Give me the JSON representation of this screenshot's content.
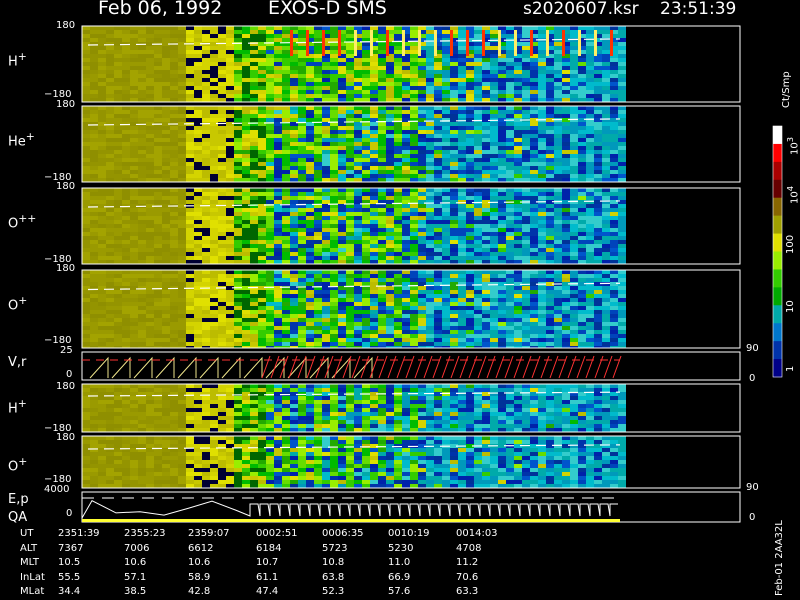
{
  "header": {
    "date": "Feb 06, 1992",
    "instrument": "EXOS-D SMS",
    "file": "s2020607.ksr",
    "time": "23:51:39"
  },
  "panels": {
    "h1": {
      "label": "H",
      "sup": "+",
      "top": "180",
      "bottom": "−180"
    },
    "he": {
      "label": "He",
      "sup": "+",
      "top": "180",
      "bottom": "−180"
    },
    "o2": {
      "label": "O",
      "sup": "++",
      "top": "180",
      "bottom": "−180"
    },
    "o1": {
      "label": "O",
      "sup": "+",
      "top": "180",
      "bottom": "−180"
    },
    "vr": {
      "label": "V,r",
      "top": "25",
      "bottom": "0",
      "right_top": "90",
      "right_bottom": "0"
    },
    "h2": {
      "label": "H",
      "sup": "+",
      "top": "180",
      "bottom": "−180"
    },
    "o3": {
      "label": "O",
      "sup": "+",
      "top": "180",
      "bottom": "−180"
    },
    "ep": {
      "label1": "E,p",
      "label2": "QA",
      "top": "4000",
      "bottom": "0",
      "right_top": "90",
      "right_bottom": "0"
    }
  },
  "colorbar": {
    "unit": "Ct/Smp",
    "labels": {
      "l1": "1",
      "l10": "10",
      "l100": "100",
      "l1000": "10",
      "l1000_exp": "3",
      "l10000": "10",
      "l10000_exp": "4"
    }
  },
  "side_note": "Feb-01  2AA32L",
  "footer": {
    "rows": [
      {
        "name": "UT",
        "values": [
          "2351:39",
          "2355:23",
          "2359:07",
          "0002:51",
          "0006:35",
          "0010:19",
          "0014:03"
        ]
      },
      {
        "name": "ALT",
        "values": [
          "7367",
          "7006",
          "6612",
          "6184",
          "5723",
          "5230",
          "4708"
        ]
      },
      {
        "name": "MLT",
        "values": [
          "10.5",
          "10.6",
          "10.6",
          "10.7",
          "10.8",
          "11.0",
          "11.2"
        ]
      },
      {
        "name": "InLat",
        "values": [
          "55.5",
          "57.1",
          "58.9",
          "61.1",
          "63.8",
          "66.9",
          "70.6"
        ]
      },
      {
        "name": "MLat",
        "values": [
          "34.4",
          "38.5",
          "42.8",
          "47.4",
          "52.3",
          "57.6",
          "63.3"
        ]
      }
    ]
  },
  "chart_data": {
    "type": "heatmap",
    "title": "Feb 06, 1992   EXOS-D SMS",
    "x_ticks": [
      "2351:39",
      "2355:23",
      "2359:07",
      "0002:51",
      "0006:35",
      "0010:19",
      "0014:03"
    ],
    "ylim": [
      -180,
      180
    ],
    "colorbar_scale": "log",
    "colorbar_range": [
      1,
      10000
    ],
    "colorbar_unit": "Ct/Smp",
    "series": [
      {
        "name": "H+"
      },
      {
        "name": "He+"
      },
      {
        "name": "O++"
      },
      {
        "name": "O+"
      },
      {
        "name": "V,r",
        "ylim": [
          0,
          25
        ]
      },
      {
        "name": "H+"
      },
      {
        "name": "O+"
      },
      {
        "name": "E,p",
        "ylim": [
          0,
          4000
        ]
      }
    ]
  }
}
